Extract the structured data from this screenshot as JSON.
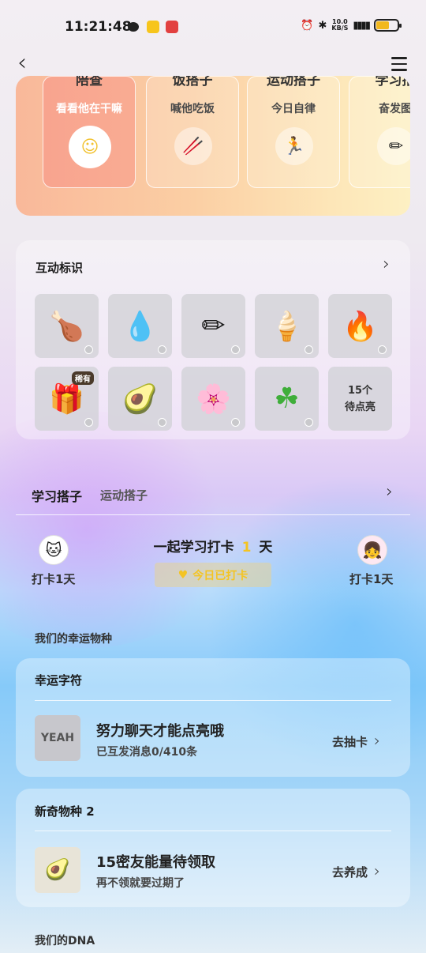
{
  "status": {
    "time": "11:21:48",
    "net_speed_top": "10.0",
    "net_speed_unit": "KB/S"
  },
  "buddies": [
    {
      "title": "陪查",
      "subtitle": "看看他在干嘛",
      "icon": "☺"
    },
    {
      "title": "饭搭子",
      "subtitle": "喊他吃饭",
      "icon": "🥢"
    },
    {
      "title": "运动搭子",
      "subtitle": "今日自律",
      "icon": "🏃"
    },
    {
      "title": "学习搭",
      "subtitle": "奋发图",
      "icon": "✏"
    }
  ],
  "interaction": {
    "title": "互动标识",
    "badges": [
      {
        "icon": "🍗"
      },
      {
        "icon": "💧"
      },
      {
        "icon": "✏"
      },
      {
        "icon": "🍦"
      },
      {
        "icon": "🔥"
      },
      {
        "icon": "🎁",
        "rare": "稀有"
      },
      {
        "icon": "🥑"
      },
      {
        "icon": "🌸"
      },
      {
        "icon": "☘"
      }
    ],
    "pending_count": "15个",
    "pending_label": "待点亮"
  },
  "partner": {
    "tab_active": "学习搭子",
    "tab_inactive": "运动搭子",
    "together_prefix": "一起学习打卡",
    "together_days": "1",
    "together_suffix": "天",
    "left_label": "打卡1天",
    "right_label": "打卡1天",
    "checkin_label": "今日已打卡"
  },
  "lucky": {
    "section_title": "我们的幸运物种",
    "char_card": {
      "title": "幸运字符",
      "row_title": "努力聊天才能点亮哦",
      "row_sub": "已互发消息0/410条",
      "action": "去抽卡"
    },
    "species_card": {
      "title": "新奇物种",
      "count": "2",
      "row_title": "15密友能量待领取",
      "row_sub": "再不领就要过期了",
      "action": "去养成"
    }
  },
  "dna": {
    "title": "我们的DNA"
  }
}
